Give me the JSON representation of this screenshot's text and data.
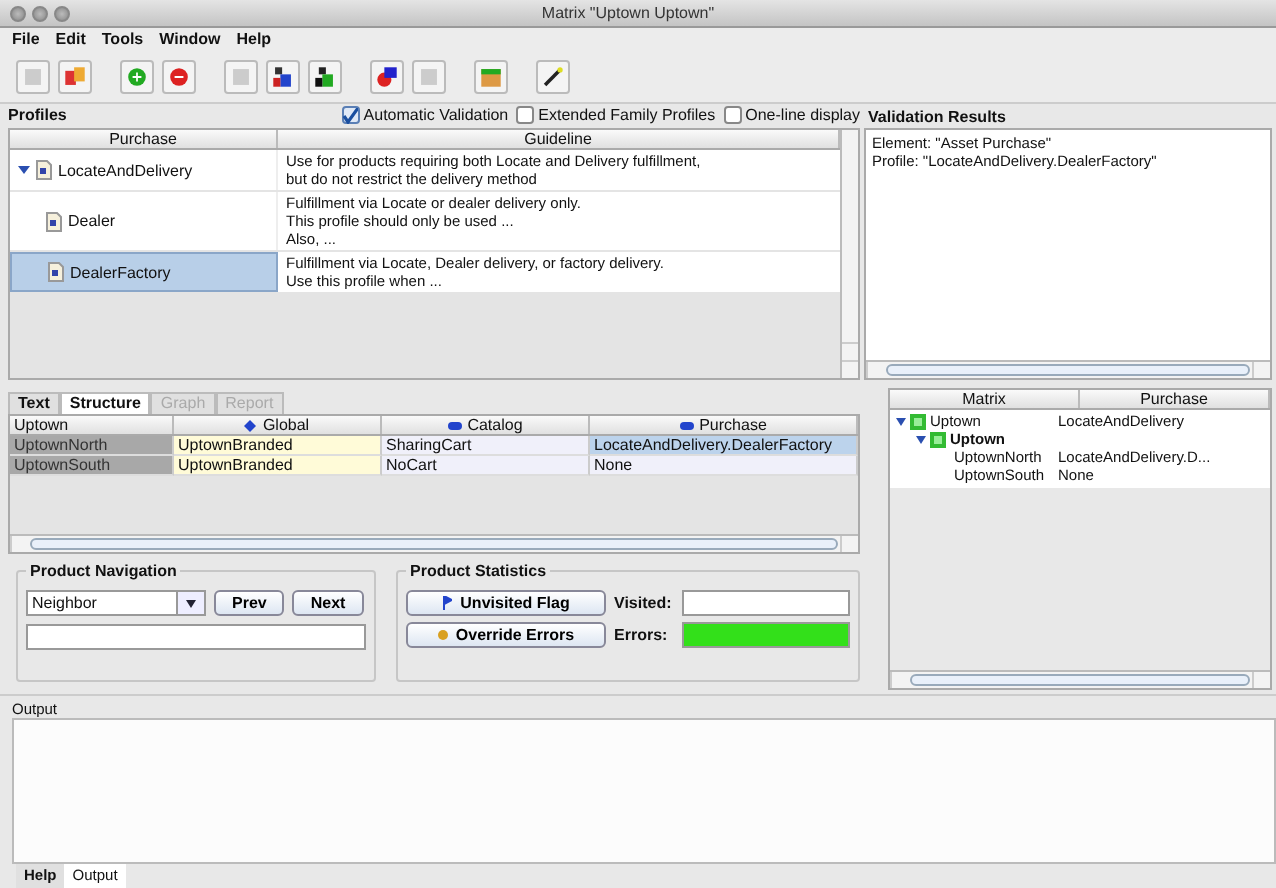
{
  "window": {
    "title": "Matrix \"Uptown Uptown\""
  },
  "menu": [
    "File",
    "Edit",
    "Tools",
    "Window",
    "Help"
  ],
  "profiles": {
    "title": "Profiles",
    "options": [
      {
        "label": "Automatic Validation",
        "checked": true
      },
      {
        "label": "Extended Family Profiles",
        "checked": false
      },
      {
        "label": "One-line display",
        "checked": false
      }
    ],
    "columns": [
      "Purchase",
      "Guideline"
    ],
    "rows": [
      {
        "name": "LocateAndDelivery",
        "expanded": true,
        "selected": false,
        "guideline": [
          "Use for products requiring both Locate and Delivery fulfillment,",
          "but do not restrict the delivery method"
        ],
        "children": [
          {
            "name": "Dealer",
            "selected": false,
            "guideline": [
              "Fulfillment via Locate or dealer delivery only.",
              "This profile should only be used ...",
              "Also, ..."
            ]
          },
          {
            "name": "DealerFactory",
            "selected": true,
            "guideline": [
              "Fulfillment via Locate, Dealer delivery, or factory delivery.",
              "Use this profile when ..."
            ]
          }
        ]
      }
    ]
  },
  "validation": {
    "title": "Validation Results",
    "lines": [
      "Element: \"Asset Purchase\"",
      "Profile: \"LocateAndDelivery.DealerFactory\""
    ]
  },
  "tabs": [
    {
      "label": "Text",
      "selected": false,
      "disabled": false
    },
    {
      "label": "Structure",
      "selected": true,
      "disabled": false
    },
    {
      "label": "Graph",
      "selected": false,
      "disabled": true
    },
    {
      "label": "Report",
      "selected": false,
      "disabled": true
    }
  ],
  "matrix": {
    "columns": [
      "Uptown",
      "Global",
      "Catalog",
      "Purchase"
    ],
    "rows": [
      {
        "cells": [
          {
            "text": "UptownNorth",
            "selected": false
          },
          {
            "text": "UptownBranded",
            "selected": false
          },
          {
            "text": "SharingCart",
            "selected": false
          },
          {
            "text": "LocateAndDelivery.DealerFactory",
            "selected": true
          }
        ]
      },
      {
        "cells": [
          {
            "text": "UptownSouth",
            "selected": false
          },
          {
            "text": "UptownBranded",
            "selected": false
          },
          {
            "text": "NoCart",
            "selected": false
          },
          {
            "text": "None",
            "selected": false
          }
        ]
      }
    ]
  },
  "navigation": {
    "title": "Product Navigation",
    "mode": "Neighbor",
    "buttons": [
      "Prev",
      "Next"
    ]
  },
  "statistics": {
    "title": "Product Statistics",
    "buttons": [
      {
        "label": "Unvisited Flag",
        "kind": "flag"
      },
      {
        "label": "Override Errors",
        "kind": "dot"
      }
    ],
    "visited_label": "Visited:",
    "errors_label": "Errors:",
    "has_errors": false
  },
  "tree": {
    "columns": [
      "Matrix",
      "Purchase"
    ],
    "nodes": [
      {
        "name": "Uptown",
        "purchase": "LocateAndDelivery",
        "expanded": true,
        "children": [
          {
            "name": "Uptown",
            "expanded": true,
            "children": [
              {
                "name": "UptownNorth",
                "purchase": "LocateAndDelivery.D..."
              },
              {
                "name": "UptownSouth",
                "purchase": "None"
              }
            ]
          }
        ]
      }
    ]
  },
  "output": {
    "title": "Output"
  },
  "bottom_tabs": [
    {
      "label": "Help",
      "selected": false
    },
    {
      "label": "Output",
      "selected": true
    }
  ]
}
